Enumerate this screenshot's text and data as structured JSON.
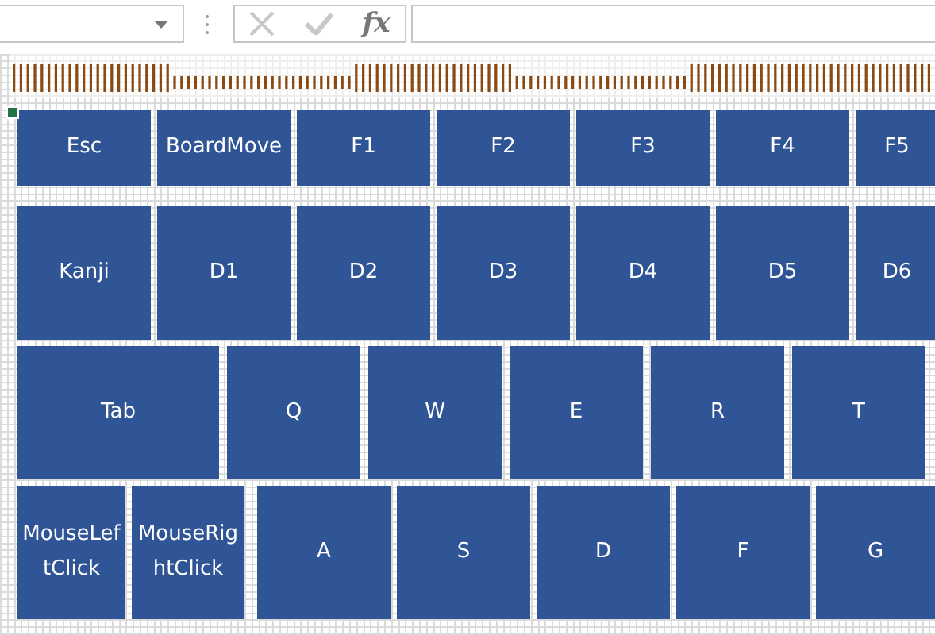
{
  "formula_bar": {
    "function_label": "fx"
  },
  "keyboard": {
    "rows": [
      {
        "keys": [
          "Esc",
          "BoardMove",
          "F1",
          "F2",
          "F3",
          "F4",
          "F5"
        ]
      },
      {
        "keys": [
          "Kanji",
          "D1",
          "D2",
          "D3",
          "D4",
          "D5",
          "D6"
        ]
      },
      {
        "keys": [
          "Tab",
          "Q",
          "W",
          "E",
          "R",
          "T"
        ]
      },
      {
        "keys": [
          "MouseLeftClick",
          "MouseRightClick",
          "A",
          "S",
          "D",
          "F",
          "G"
        ]
      }
    ]
  }
}
